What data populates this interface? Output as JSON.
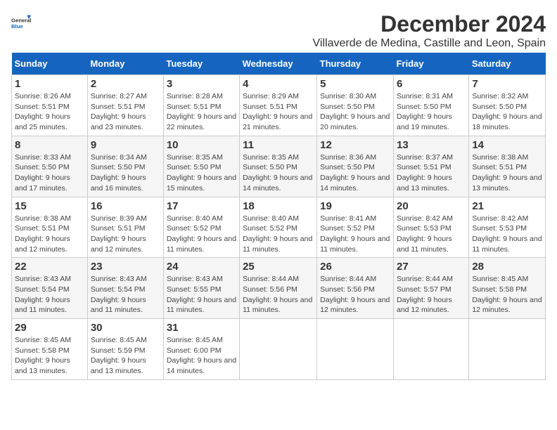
{
  "header": {
    "logo_general": "General",
    "logo_blue": "Blue",
    "title": "December 2024",
    "subtitle": "Villaverde de Medina, Castille and Leon, Spain"
  },
  "calendar": {
    "days_of_week": [
      "Sunday",
      "Monday",
      "Tuesday",
      "Wednesday",
      "Thursday",
      "Friday",
      "Saturday"
    ],
    "weeks": [
      [
        {
          "day": 1,
          "detail": "Sunrise: 8:26 AM\nSunset: 5:51 PM\nDaylight: 9 hours and 25 minutes."
        },
        {
          "day": 2,
          "detail": "Sunrise: 8:27 AM\nSunset: 5:51 PM\nDaylight: 9 hours and 23 minutes."
        },
        {
          "day": 3,
          "detail": "Sunrise: 8:28 AM\nSunset: 5:51 PM\nDaylight: 9 hours and 22 minutes."
        },
        {
          "day": 4,
          "detail": "Sunrise: 8:29 AM\nSunset: 5:51 PM\nDaylight: 9 hours and 21 minutes."
        },
        {
          "day": 5,
          "detail": "Sunrise: 8:30 AM\nSunset: 5:50 PM\nDaylight: 9 hours and 20 minutes."
        },
        {
          "day": 6,
          "detail": "Sunrise: 8:31 AM\nSunset: 5:50 PM\nDaylight: 9 hours and 19 minutes."
        },
        {
          "day": 7,
          "detail": "Sunrise: 8:32 AM\nSunset: 5:50 PM\nDaylight: 9 hours and 18 minutes."
        }
      ],
      [
        {
          "day": 8,
          "detail": "Sunrise: 8:33 AM\nSunset: 5:50 PM\nDaylight: 9 hours and 17 minutes."
        },
        {
          "day": 9,
          "detail": "Sunrise: 8:34 AM\nSunset: 5:50 PM\nDaylight: 9 hours and 16 minutes."
        },
        {
          "day": 10,
          "detail": "Sunrise: 8:35 AM\nSunset: 5:50 PM\nDaylight: 9 hours and 15 minutes."
        },
        {
          "day": 11,
          "detail": "Sunrise: 8:35 AM\nSunset: 5:50 PM\nDaylight: 9 hours and 14 minutes."
        },
        {
          "day": 12,
          "detail": "Sunrise: 8:36 AM\nSunset: 5:50 PM\nDaylight: 9 hours and 14 minutes."
        },
        {
          "day": 13,
          "detail": "Sunrise: 8:37 AM\nSunset: 5:51 PM\nDaylight: 9 hours and 13 minutes."
        },
        {
          "day": 14,
          "detail": "Sunrise: 8:38 AM\nSunset: 5:51 PM\nDaylight: 9 hours and 13 minutes."
        }
      ],
      [
        {
          "day": 15,
          "detail": "Sunrise: 8:38 AM\nSunset: 5:51 PM\nDaylight: 9 hours and 12 minutes."
        },
        {
          "day": 16,
          "detail": "Sunrise: 8:39 AM\nSunset: 5:51 PM\nDaylight: 9 hours and 12 minutes."
        },
        {
          "day": 17,
          "detail": "Sunrise: 8:40 AM\nSunset: 5:52 PM\nDaylight: 9 hours and 11 minutes."
        },
        {
          "day": 18,
          "detail": "Sunrise: 8:40 AM\nSunset: 5:52 PM\nDaylight: 9 hours and 11 minutes."
        },
        {
          "day": 19,
          "detail": "Sunrise: 8:41 AM\nSunset: 5:52 PM\nDaylight: 9 hours and 11 minutes."
        },
        {
          "day": 20,
          "detail": "Sunrise: 8:42 AM\nSunset: 5:53 PM\nDaylight: 9 hours and 11 minutes."
        },
        {
          "day": 21,
          "detail": "Sunrise: 8:42 AM\nSunset: 5:53 PM\nDaylight: 9 hours and 11 minutes."
        }
      ],
      [
        {
          "day": 22,
          "detail": "Sunrise: 8:43 AM\nSunset: 5:54 PM\nDaylight: 9 hours and 11 minutes."
        },
        {
          "day": 23,
          "detail": "Sunrise: 8:43 AM\nSunset: 5:54 PM\nDaylight: 9 hours and 11 minutes."
        },
        {
          "day": 24,
          "detail": "Sunrise: 8:43 AM\nSunset: 5:55 PM\nDaylight: 9 hours and 11 minutes."
        },
        {
          "day": 25,
          "detail": "Sunrise: 8:44 AM\nSunset: 5:56 PM\nDaylight: 9 hours and 11 minutes."
        },
        {
          "day": 26,
          "detail": "Sunrise: 8:44 AM\nSunset: 5:56 PM\nDaylight: 9 hours and 12 minutes."
        },
        {
          "day": 27,
          "detail": "Sunrise: 8:44 AM\nSunset: 5:57 PM\nDaylight: 9 hours and 12 minutes."
        },
        {
          "day": 28,
          "detail": "Sunrise: 8:45 AM\nSunset: 5:58 PM\nDaylight: 9 hours and 12 minutes."
        }
      ],
      [
        {
          "day": 29,
          "detail": "Sunrise: 8:45 AM\nSunset: 5:58 PM\nDaylight: 9 hours and 13 minutes."
        },
        {
          "day": 30,
          "detail": "Sunrise: 8:45 AM\nSunset: 5:59 PM\nDaylight: 9 hours and 13 minutes."
        },
        {
          "day": 31,
          "detail": "Sunrise: 8:45 AM\nSunset: 6:00 PM\nDaylight: 9 hours and 14 minutes."
        },
        null,
        null,
        null,
        null
      ]
    ]
  }
}
